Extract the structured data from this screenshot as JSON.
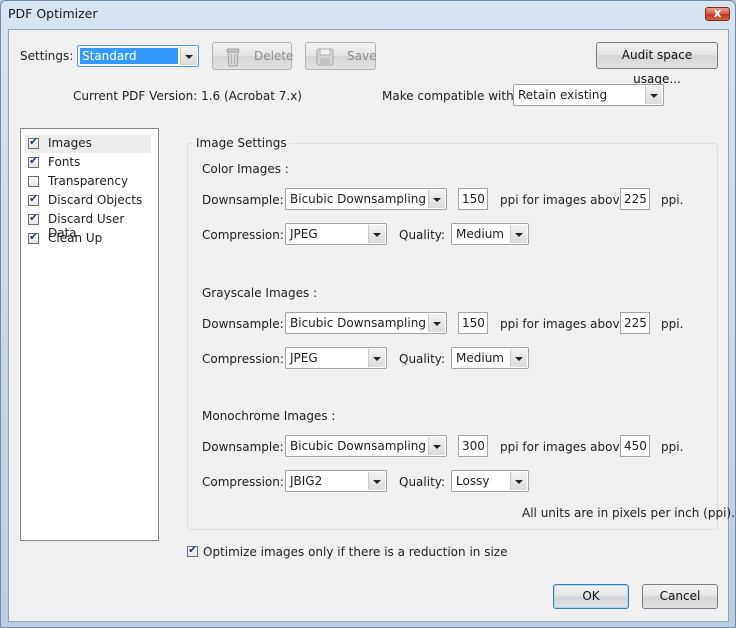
{
  "window": {
    "title": "PDF Optimizer",
    "close_glyph": "x"
  },
  "toolbar": {
    "settings_label": "Settings:",
    "settings_value": "Standard",
    "delete_label": "Delete",
    "save_label": "Save",
    "audit_label": "Audit space usage..."
  },
  "info": {
    "pdf_version": "Current PDF Version: 1.6 (Acrobat 7.x)",
    "compatible_label": "Make compatible with:",
    "compatible_value": "Retain existing"
  },
  "panel_list": {
    "items": [
      {
        "label": "Images",
        "checked": true
      },
      {
        "label": "Fonts",
        "checked": true
      },
      {
        "label": "Transparency",
        "checked": false
      },
      {
        "label": "Discard Objects",
        "checked": true
      },
      {
        "label": "Discard User Data",
        "checked": true
      },
      {
        "label": "Clean Up",
        "checked": true
      }
    ]
  },
  "image_settings": {
    "group_title": "Image Settings",
    "labels": {
      "downsample": "Downsample:",
      "compression": "Compression:",
      "quality": "Quality:",
      "ppi_above": "ppi for images above",
      "ppi": "ppi."
    },
    "sections": [
      {
        "title": "Color Images :",
        "downsample": "Bicubic Downsampling to",
        "ppi": "150",
        "above": "225",
        "compression": "JPEG",
        "quality": "Medium"
      },
      {
        "title": "Grayscale Images :",
        "downsample": "Bicubic Downsampling to",
        "ppi": "150",
        "above": "225",
        "compression": "JPEG",
        "quality": "Medium"
      },
      {
        "title": "Monochrome Images :",
        "downsample": "Bicubic Downsampling to",
        "ppi": "300",
        "above": "450",
        "compression": "JBIG2",
        "quality": "Lossy"
      }
    ],
    "units_note": "All units are in pixels per inch (ppi)."
  },
  "optimize_only": {
    "label": "Optimize images only if there is a reduction in size",
    "checked": true
  },
  "footer": {
    "ok_label": "OK",
    "cancel_label": "Cancel"
  },
  "icons": {
    "delete": "trash-icon",
    "save": "floppy-disk-icon",
    "check": "checkmark-icon",
    "dropdown": "chevron-down-icon"
  },
  "colors": {
    "selection": "#3399ff",
    "title_bar": "#c6d6ea",
    "close_button": "#c8472c"
  }
}
